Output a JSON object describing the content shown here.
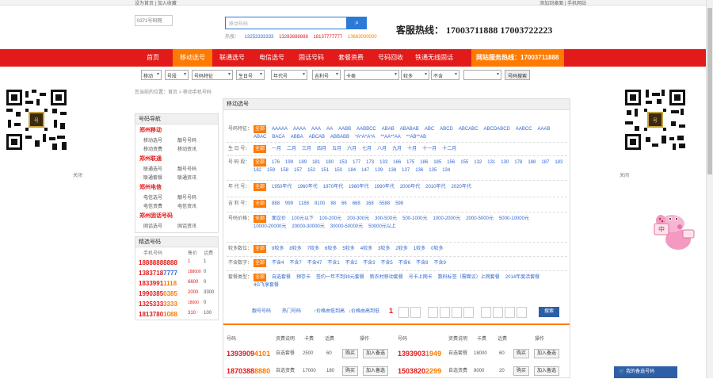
{
  "topbar": {
    "left": "设为首页  |  加入收藏",
    "right": "添加到桌面  |  手机网站"
  },
  "header": {
    "logo_alt": "0371号码网",
    "search_placeholder": "移动号码",
    "search_icon": "search-icon",
    "hot_label": "热搜：",
    "hot_numbers": [
      "13253333333",
      "13283888888",
      "18137777777",
      "13663000000"
    ],
    "hotline": "客服热线： 17003711888 17003722223"
  },
  "nav": {
    "items": [
      "首页",
      "移动选号",
      "联通选号",
      "电信选号",
      "固话号码",
      "套餐资费",
      "号码回收",
      "铁通无线固话"
    ],
    "active": 1,
    "hotline": "网站服务热线：17003711888"
  },
  "filters": {
    "selects": [
      "移动",
      "号段",
      "号码特征",
      "生日号",
      "年代号",
      "吉利号",
      "卡类",
      "较多",
      "不含"
    ],
    "search_label": "号码搜索"
  },
  "breadcrumb": "您当前的位置：首页 > 移动手机号码",
  "qr": {
    "left_label": "关闭",
    "right_label": "关闭",
    "center_text": "0371号码网"
  },
  "sidebar": {
    "nav_title": "号码导航",
    "categories": [
      {
        "name": "郑州移动",
        "subs": [
          [
            "移动选号",
            "靓号号码"
          ],
          [
            "移动资费",
            "移动资讯"
          ]
        ]
      },
      {
        "name": "郑州联通",
        "subs": [
          [
            "联通选号",
            "靓号号码"
          ],
          [
            "联通套餐",
            "联通资讯"
          ]
        ]
      },
      {
        "name": "郑州电信",
        "subs": [
          [
            "电信选号",
            "靓号号码"
          ],
          [
            "电信资费",
            "电信资讯"
          ]
        ]
      },
      {
        "name": "郑州固话号码",
        "subs": [
          [
            "固话选号",
            "固话资讯"
          ]
        ]
      }
    ],
    "picks_title": "精选号码",
    "picks_header": [
      "手机号码",
      "售价",
      "话费"
    ],
    "picks": [
      {
        "a": "1888888",
        "b": "8888",
        "price": "1",
        "fee": "1"
      },
      {
        "a": "1383718",
        "b": "7777",
        "price": "188000",
        "fee": "0"
      },
      {
        "a": "1833991",
        "b": "1118",
        "price": "6600",
        "fee": "0"
      },
      {
        "a": "1990385",
        "b": "0385",
        "price": "2000",
        "fee": "3300"
      },
      {
        "a": "1325333",
        "b": "3333",
        "price": "18000",
        "fee": "0"
      },
      {
        "a": "1813780",
        "b": "1088",
        "price": "310",
        "fee": "100"
      }
    ]
  },
  "main": {
    "title": "移动选号",
    "rows": [
      {
        "label": "号码特征：",
        "values": [
          "全部",
          "AAAAA",
          "AAAA",
          "AAA",
          "AA",
          "AABB",
          "AABBCC",
          "ABAB",
          "ABABAB",
          "ABC",
          "ABCD",
          "ABCABC",
          "ABCDABCD",
          "AABCC",
          "AAAB",
          "ABAC",
          "BACA",
          "ABBA",
          "ABCAB",
          "ABBABB",
          "*A*A*A*A",
          "**AA**AA",
          "**AB**AB"
        ]
      },
      {
        "label": "生 日 号：",
        "values": [
          "全部",
          "一月",
          "二月",
          "三月",
          "四月",
          "五月",
          "六月",
          "七月",
          "八月",
          "九月",
          "十月",
          "十一月",
          "十二月"
        ]
      },
      {
        "label": "号 码 段：",
        "values": [
          "全部",
          "176",
          "199",
          "189",
          "181",
          "180",
          "153",
          "177",
          "173",
          "133",
          "166",
          "175",
          "186",
          "185",
          "156",
          "155",
          "132",
          "131",
          "130",
          "178",
          "188",
          "187",
          "183",
          "182",
          "159",
          "158",
          "157",
          "152",
          "151",
          "150",
          "184",
          "147",
          "139",
          "138",
          "137",
          "136",
          "135",
          "134"
        ]
      },
      {
        "label": "年 代 号：",
        "values": [
          "全部",
          "1950年代",
          "1960年代",
          "1970年代",
          "1980年代",
          "1990年代",
          "2000年代",
          "2010年代",
          "2020年代"
        ]
      },
      {
        "label": "吉 利 号：",
        "values": [
          "全部",
          "888",
          "999",
          "1188",
          "8100",
          "88",
          "66",
          "668",
          "168",
          "5588",
          "598"
        ]
      },
      {
        "label": "号码价格：",
        "values": [
          "全部",
          "面议价",
          "100元以下",
          "100-200元",
          "200-300元",
          "300-500元",
          "500-1000元",
          "1000-2000元",
          "2000-5000元",
          "5000-10000元",
          "10000-20000元",
          "20000-30000元",
          "30000-50000元",
          "50000元以上"
        ]
      },
      {
        "label": "较多数位：",
        "values": [
          "全部",
          "9较多",
          "8较多",
          "7较多",
          "6较多",
          "5较多",
          "4较多",
          "3较多",
          "2较多",
          "1较多",
          "0较多"
        ]
      },
      {
        "label": "不含数字：",
        "values": [
          "全部",
          "不含4",
          "不含7",
          "不含47",
          "不含1",
          "不含2",
          "不含3",
          "不含5",
          "不含6",
          "不含8",
          "不含9"
        ]
      },
      {
        "label": "套餐类型：",
        "values": [
          "全部",
          "自选套餐",
          "预存卡",
          "签约一年不到39元套餐",
          "新农村移动套餐",
          "号卡上网卡",
          "数码标签（需面议）上网套餐",
          "2014年度活套餐",
          "4G飞享套餐"
        ]
      }
    ],
    "pager": {
      "prev": "靓号号码",
      "hot": "热门号码",
      "asc": "价格由低到高",
      "desc": "价格由高到低",
      "page": "1",
      "go": "搜索"
    },
    "table_header": [
      "号码",
      "资费说明",
      "卡费",
      "话费",
      "操作",
      "号码",
      "资费说明",
      "卡费",
      "话费",
      "操作"
    ],
    "table_rows": [
      {
        "l": {
          "a": "1393909",
          "b": "4101",
          "plan": "自选套餐",
          "price": "2500",
          "fee": "60"
        },
        "r": {
          "a": "1393903",
          "b": "1949",
          "plan": "自选套餐",
          "price": "18000",
          "fee": "60"
        }
      },
      {
        "l": {
          "a": "1870388",
          "b": "8880",
          "plan": "自选资费",
          "price": "17000",
          "fee": "180"
        },
        "r": {
          "a": "1503820",
          "b": "2299",
          "plan": "自选资费",
          "price": "9000",
          "fee": "20"
        }
      }
    ],
    "buy_label": "购买",
    "cart_label": "加入备选"
  },
  "cart": "我的备选号码",
  "colors": {
    "nav_red": "#e21a1a",
    "orange": "#ff7a00",
    "blue": "#2d7ad6"
  }
}
